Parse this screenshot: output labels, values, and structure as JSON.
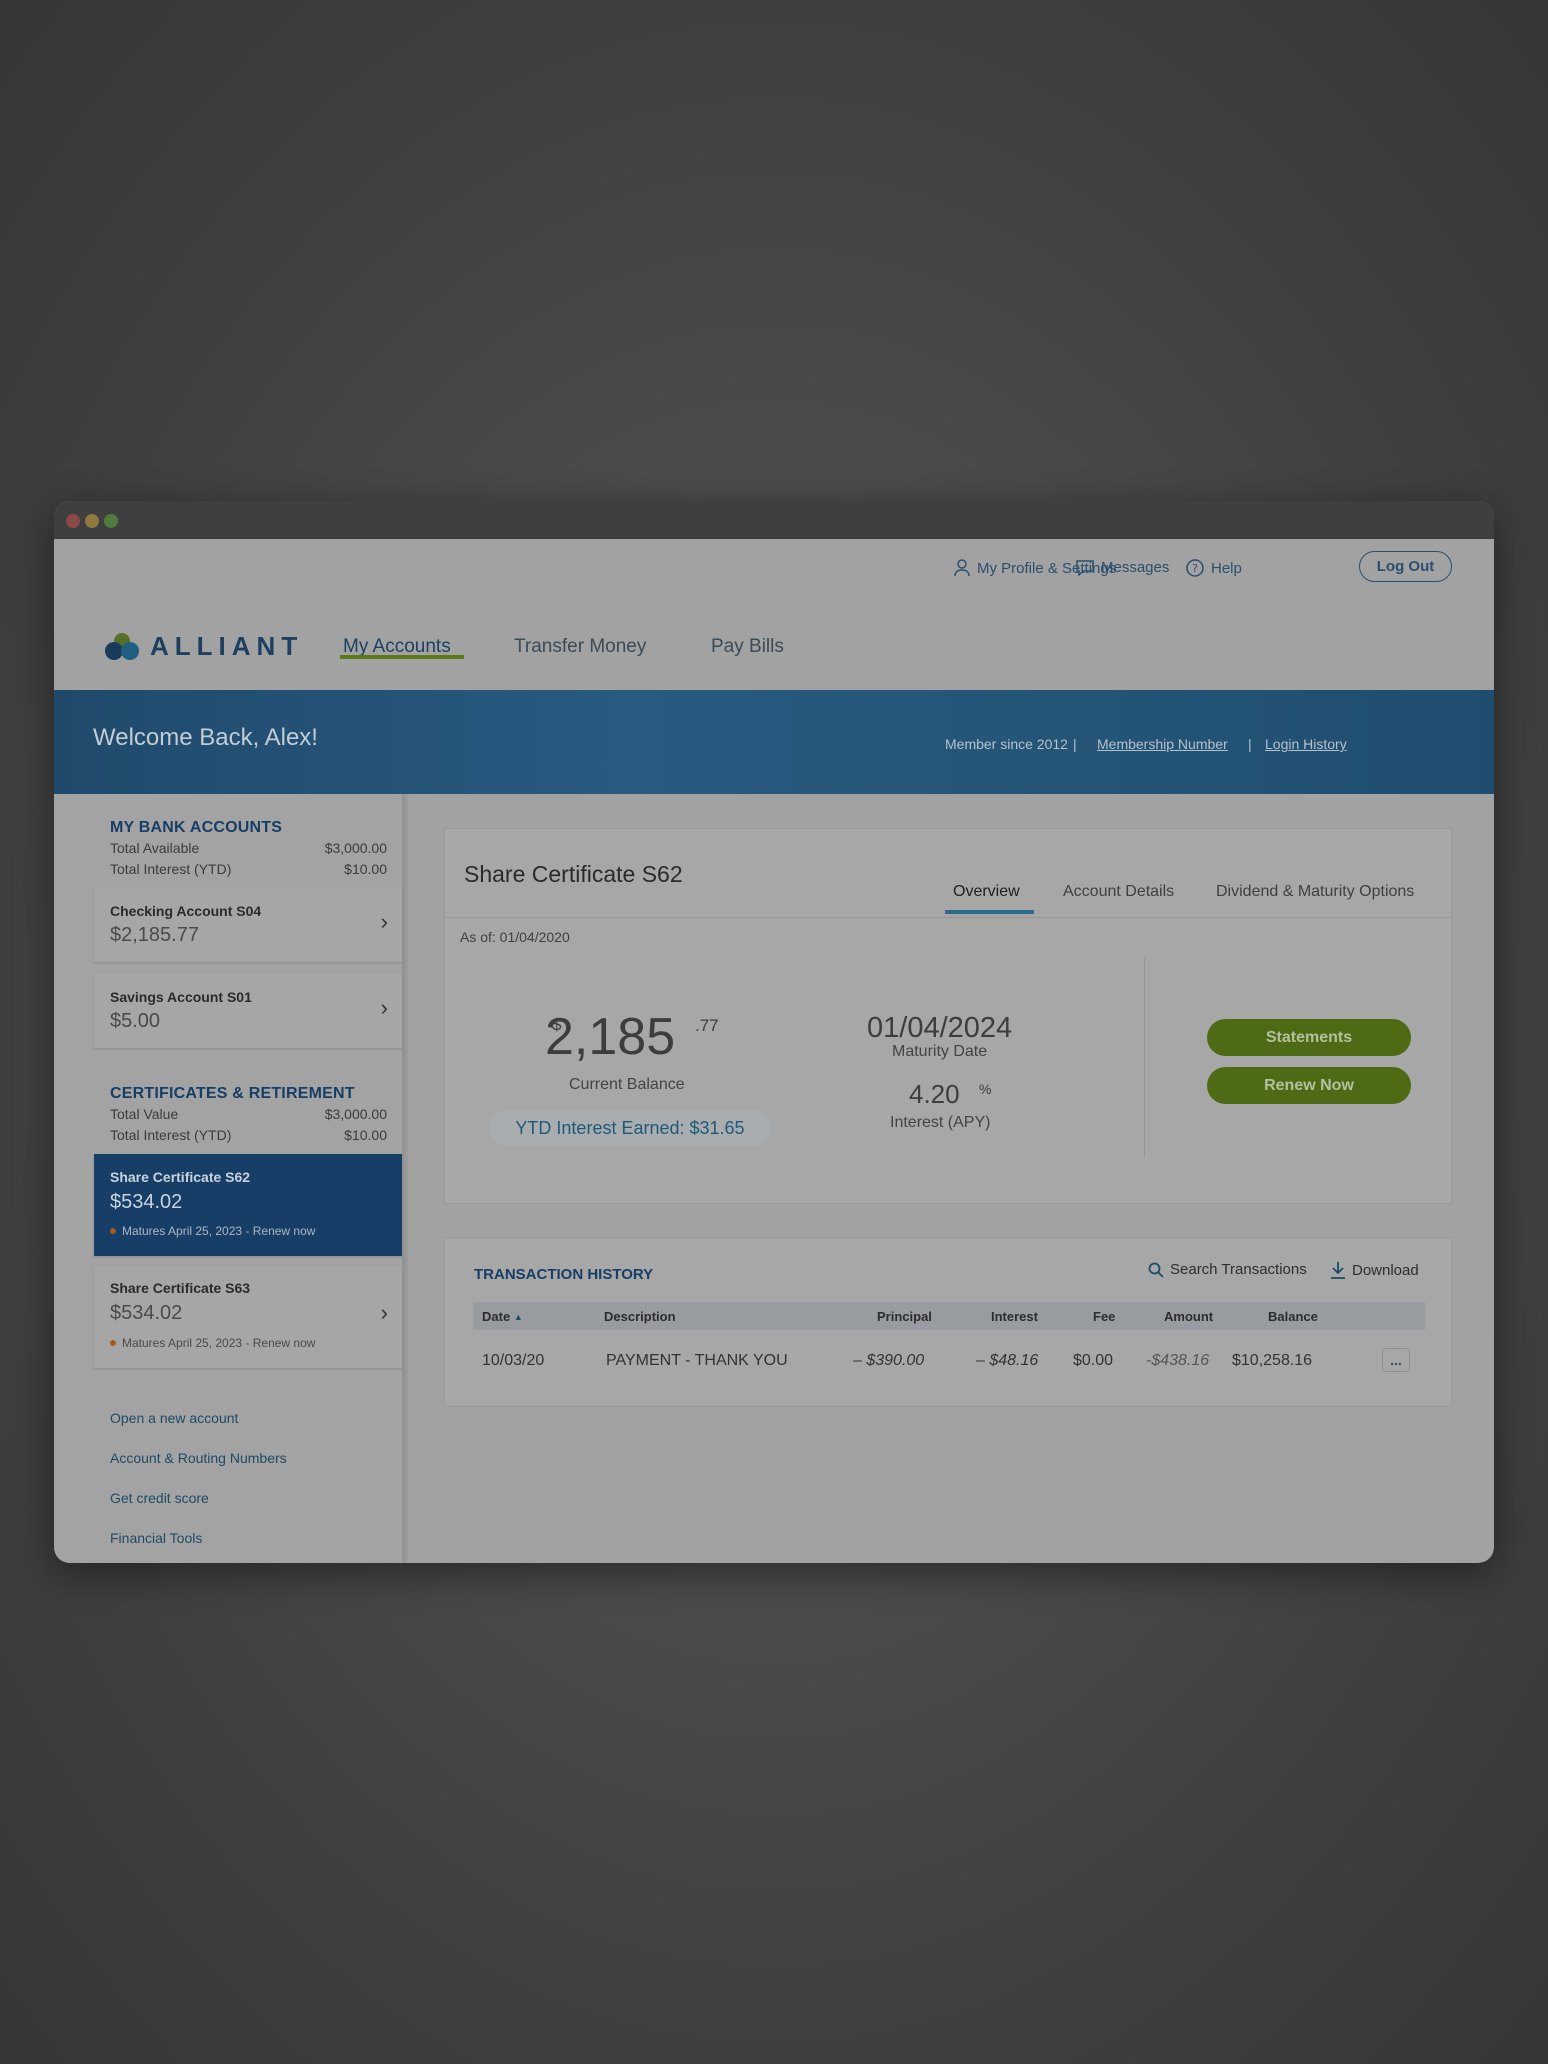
{
  "topbar": {
    "profile_label": "My Profile & Settings",
    "messages_label": "Messages",
    "help_label": "Help",
    "logout_label": "Log Out"
  },
  "brand": {
    "name": "ALLIANT"
  },
  "nav": {
    "items": [
      "My Accounts",
      "Transfer Money",
      "Pay Bills"
    ],
    "active": "My Accounts"
  },
  "banner": {
    "welcome": "Welcome Back, Alex!",
    "member_since": "Member since 2012",
    "separator": "|",
    "membership_link": "Membership Number",
    "login_history_link": "Login History"
  },
  "sidebar": {
    "bank": {
      "title": "MY BANK ACCOUNTS",
      "rows": [
        {
          "label": "Total Available",
          "value": "$3,000.00"
        },
        {
          "label": "Total Interest (YTD)",
          "value": "$10.00"
        }
      ],
      "accounts": [
        {
          "name": "Checking Account S04",
          "balance": "$2,185.77"
        },
        {
          "name": "Savings Account S01",
          "balance": "$5.00"
        }
      ]
    },
    "certs": {
      "title": "CERTIFICATES & RETIREMENT",
      "rows": [
        {
          "label": "Total Value",
          "value": "$3,000.00"
        },
        {
          "label": "Total Interest (YTD)",
          "value": "$10.00"
        }
      ],
      "accounts": [
        {
          "name": "Share Certificate S62",
          "balance": "$534.02",
          "note": "Matures April 25, 2023 - Renew now",
          "selected": true
        },
        {
          "name": "Share Certificate S63",
          "balance": "$534.02",
          "note": "Matures April 25, 2023 - Renew now",
          "selected": false
        }
      ]
    },
    "links": [
      "Open a new account",
      "Account & Routing Numbers",
      "Get credit score",
      "Financial Tools"
    ]
  },
  "overview": {
    "title": "Share Certificate S62",
    "tabs": [
      "Overview",
      "Account Details",
      "Dividend & Maturity Options"
    ],
    "active_tab": "Overview",
    "as_of": "As of: 01/04/2020",
    "balance": {
      "currency": "$",
      "whole": "2,185",
      "cents": ".77",
      "label": "Current Balance"
    },
    "ytd_interest": "YTD Interest Earned: $31.65",
    "maturity": {
      "value": "01/04/2024",
      "label": "Maturity Date"
    },
    "apy": {
      "value": "4.20",
      "unit": "%",
      "label": "Interest (APY)"
    },
    "buttons": {
      "statements": "Statements",
      "renew": "Renew Now"
    }
  },
  "transactions": {
    "title": "TRANSACTION HISTORY",
    "search_label": "Search Transactions",
    "download_label": "Download",
    "columns": [
      "Date",
      "Description",
      "Principal",
      "Interest",
      "Fee",
      "Amount",
      "Balance"
    ],
    "rows": [
      {
        "date": "10/03/20",
        "description": "PAYMENT - THANK YOU",
        "principal": "– $390.00",
        "interest": "– $48.16",
        "fee": "$0.00",
        "amount": "-$438.16",
        "balance": "$10,258.16"
      }
    ],
    "more_label": "..."
  },
  "colors": {
    "brand_blue": "#173e66",
    "accent_green": "#4d6b15",
    "banner": "#245577"
  }
}
